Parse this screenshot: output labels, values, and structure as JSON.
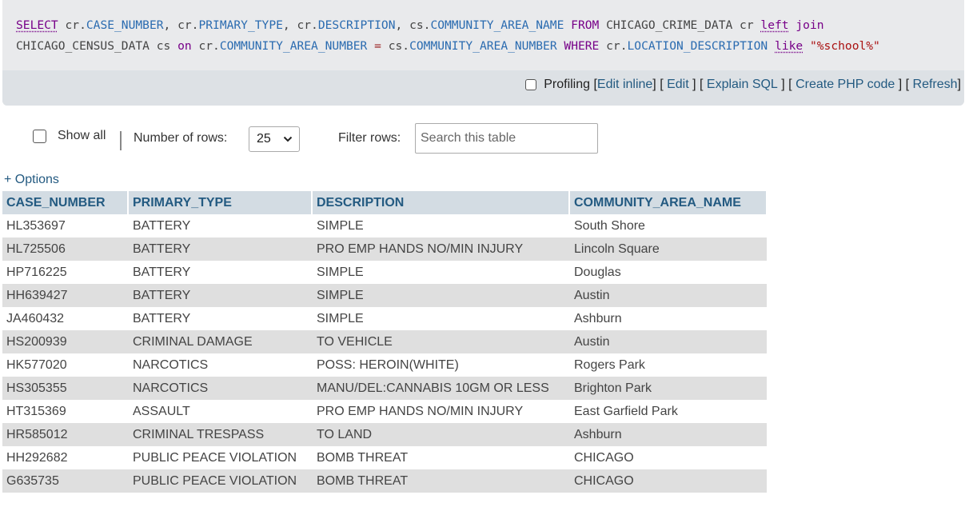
{
  "sql": {
    "line1": [
      {
        "t": "SELECT",
        "c": "kw-u"
      },
      {
        "t": " cr.",
        "c": "tbl"
      },
      {
        "t": "CASE_NUMBER",
        "c": "col"
      },
      {
        "t": ", cr.",
        "c": "tbl"
      },
      {
        "t": "PRIMARY_TYPE",
        "c": "col"
      },
      {
        "t": ", cr.",
        "c": "tbl"
      },
      {
        "t": "DESCRIPTION",
        "c": "col"
      },
      {
        "t": ", cs.",
        "c": "tbl"
      },
      {
        "t": "COMMUNITY_AREA_NAME",
        "c": "col"
      },
      {
        "t": " ",
        "c": "tbl"
      },
      {
        "t": "FROM",
        "c": "kw"
      },
      {
        "t": " CHICAGO_CRIME_DATA cr ",
        "c": "tbl"
      },
      {
        "t": "left",
        "c": "kw-u"
      },
      {
        "t": " ",
        "c": "tbl"
      },
      {
        "t": "join",
        "c": "kw"
      }
    ],
    "line2": [
      {
        "t": "CHICAGO_CENSUS_DATA cs ",
        "c": "tbl"
      },
      {
        "t": "on",
        "c": "kw"
      },
      {
        "t": " cr.",
        "c": "tbl"
      },
      {
        "t": "COMMUNITY_AREA_NUMBER",
        "c": "col"
      },
      {
        "t": " ",
        "c": "tbl"
      },
      {
        "t": "=",
        "c": "op"
      },
      {
        "t": " cs.",
        "c": "tbl"
      },
      {
        "t": "COMMUNITY_AREA_NUMBER",
        "c": "col"
      },
      {
        "t": " ",
        "c": "tbl"
      },
      {
        "t": "WHERE",
        "c": "kw"
      },
      {
        "t": " cr.",
        "c": "tbl"
      },
      {
        "t": "LOCATION_DESCRIPTION",
        "c": "col"
      },
      {
        "t": " ",
        "c": "tbl"
      },
      {
        "t": "like",
        "c": "kw-u"
      },
      {
        "t": " ",
        "c": "tbl"
      },
      {
        "t": "\"%school%\"",
        "c": "str"
      }
    ]
  },
  "toolbar": {
    "profiling_label": "Profiling",
    "edit_inline": "Edit inline",
    "edit": "Edit",
    "explain_sql": "Explain SQL",
    "create_php": "Create PHP code",
    "refresh": "Refresh"
  },
  "controls": {
    "show_all_label": "Show all",
    "rows_label": "Number of rows:",
    "rows_value": "25",
    "filter_label": "Filter rows:",
    "search_placeholder": "Search this table"
  },
  "options_link": "+ Options",
  "table": {
    "headers": [
      "CASE_NUMBER",
      "PRIMARY_TYPE",
      "DESCRIPTION",
      "COMMUNITY_AREA_NAME"
    ],
    "rows": [
      [
        "HL353697",
        "BATTERY",
        "SIMPLE",
        "South Shore"
      ],
      [
        "HL725506",
        "BATTERY",
        "PRO EMP HANDS NO/MIN INJURY",
        "Lincoln Square"
      ],
      [
        "HP716225",
        "BATTERY",
        "SIMPLE",
        "Douglas"
      ],
      [
        "HH639427",
        "BATTERY",
        "SIMPLE",
        "Austin"
      ],
      [
        "JA460432",
        "BATTERY",
        "SIMPLE",
        "Ashburn"
      ],
      [
        "HS200939",
        "CRIMINAL DAMAGE",
        "TO VEHICLE",
        "Austin"
      ],
      [
        "HK577020",
        "NARCOTICS",
        "POSS: HEROIN(WHITE)",
        "Rogers Park"
      ],
      [
        "HS305355",
        "NARCOTICS",
        "MANU/DEL:CANNABIS 10GM OR LESS",
        "Brighton Park"
      ],
      [
        "HT315369",
        "ASSAULT",
        "PRO EMP HANDS NO/MIN INJURY",
        "East Garfield Park"
      ],
      [
        "HR585012",
        "CRIMINAL TRESPASS",
        "TO LAND",
        "Ashburn"
      ],
      [
        "HH292682",
        "PUBLIC PEACE VIOLATION",
        "BOMB THREAT",
        "CHICAGO"
      ],
      [
        "G635735",
        "PUBLIC PEACE VIOLATION",
        "BOMB THREAT",
        "CHICAGO"
      ]
    ]
  }
}
